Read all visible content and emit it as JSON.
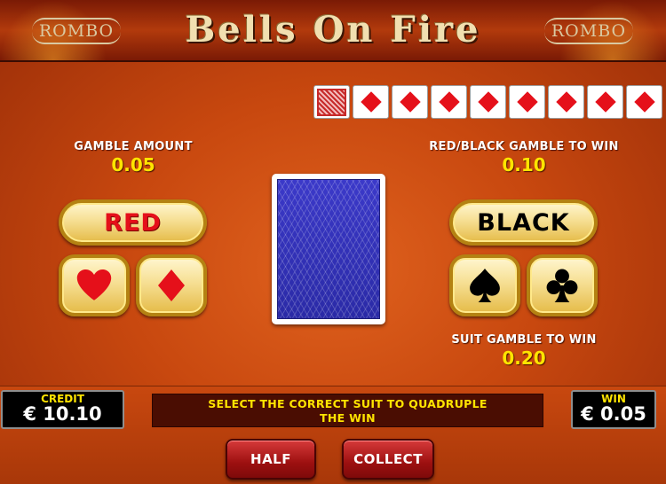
{
  "header": {
    "brand_left": "ROMBO",
    "brand_right": "ROMBO",
    "title": "Bells On Fire"
  },
  "history": [
    {
      "type": "card-back"
    },
    {
      "type": "diamond"
    },
    {
      "type": "diamond"
    },
    {
      "type": "diamond"
    },
    {
      "type": "diamond"
    },
    {
      "type": "diamond"
    },
    {
      "type": "diamond"
    },
    {
      "type": "diamond"
    },
    {
      "type": "diamond"
    }
  ],
  "gamble_amount": {
    "label": "GAMBLE AMOUNT",
    "value": "0.05"
  },
  "redblack": {
    "label": "RED/BLACK GAMBLE TO WIN",
    "value": "0.10"
  },
  "suit_gamble": {
    "label": "SUIT GAMBLE TO WIN",
    "value": "0.20"
  },
  "buttons": {
    "red": "RED",
    "black": "BLACK",
    "half": "HALF",
    "collect": "COLLECT"
  },
  "suits": {
    "heart": "heart-icon",
    "diamond": "diamond-icon",
    "spade": "spade-icon",
    "club": "club-icon"
  },
  "credit": {
    "label": "CREDIT",
    "value": "€ 10.10"
  },
  "win": {
    "label": "WIN",
    "value": "€ 0.05"
  },
  "message": {
    "line1": "SELECT THE CORRECT SUIT TO QUADRUPLE",
    "line2": "THE WIN"
  },
  "colors": {
    "red_suit": "#e5101a",
    "black_suit": "#000000",
    "value_yellow": "#ffe400",
    "card_back_blue": "#3b39c9"
  }
}
